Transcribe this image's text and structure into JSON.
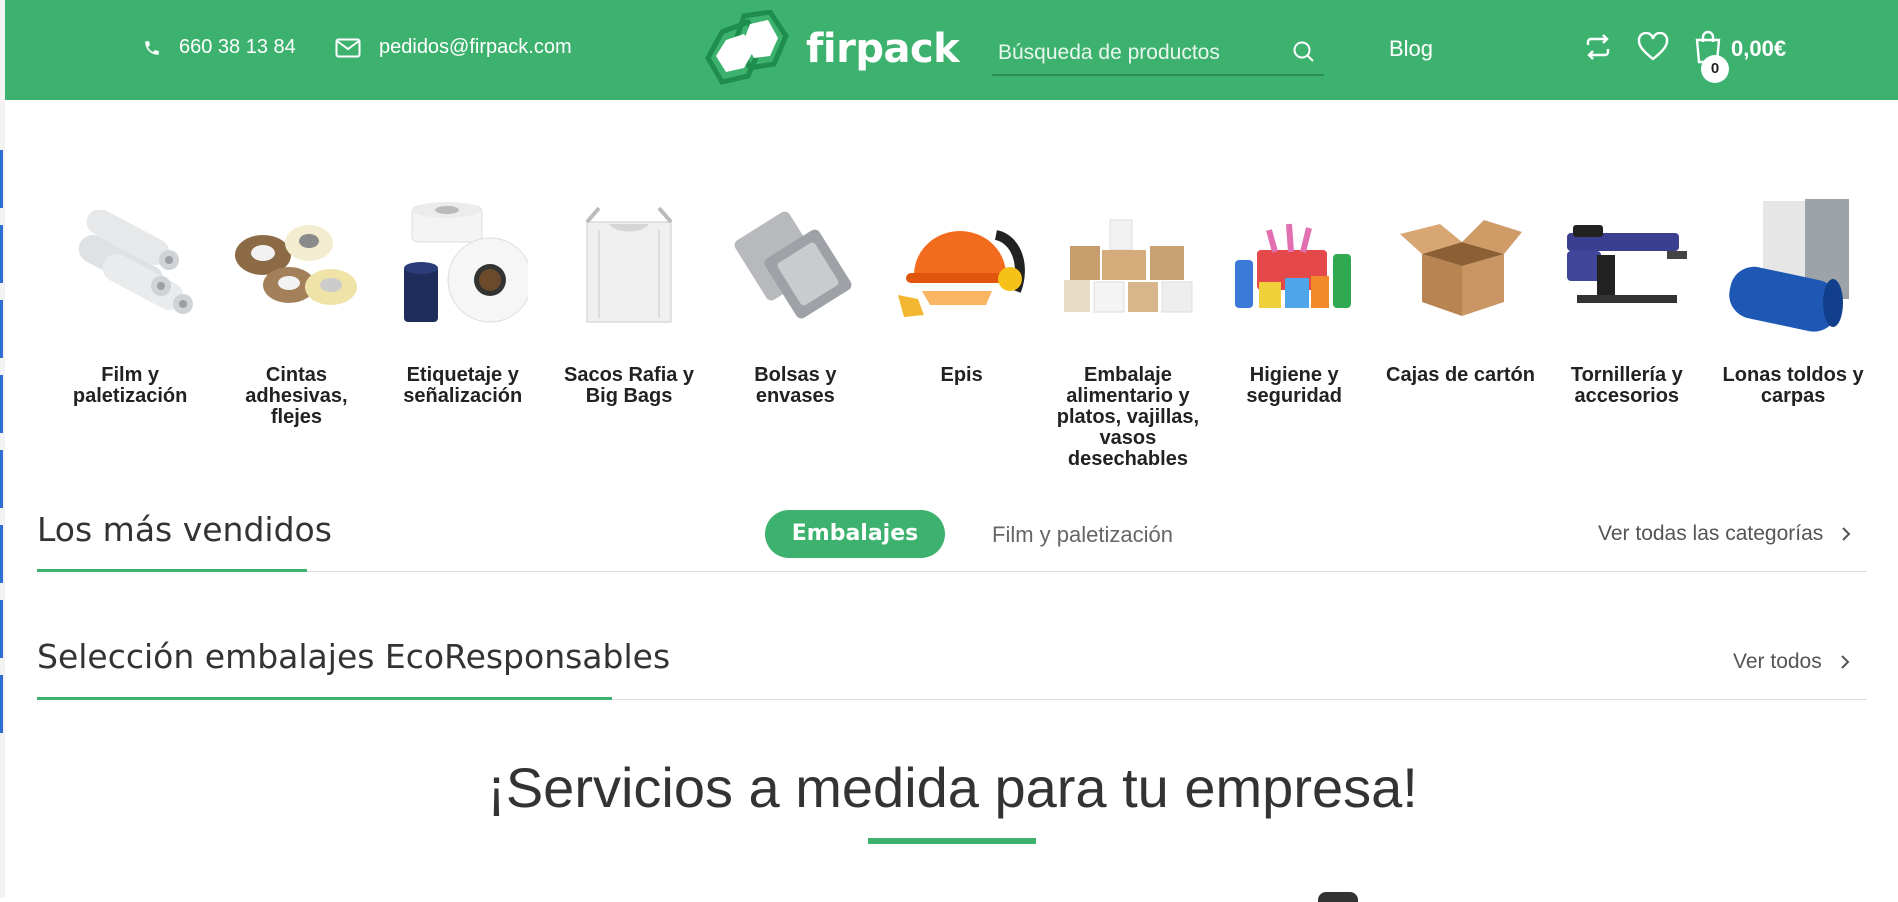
{
  "header": {
    "phone": "660 38 13 84",
    "email": "pedidos@firpack.com",
    "logo_text": "firpack",
    "search_placeholder": "Búsqueda de productos",
    "blog": "Blog",
    "cart_count": "0",
    "cart_total": "0,00€"
  },
  "categories": [
    {
      "label": "Film y paletización",
      "icon": "stretch-film-rolls"
    },
    {
      "label": "Cintas adhesivas, flejes",
      "icon": "tape-rolls"
    },
    {
      "label": "Etiquetaje y señalización",
      "icon": "label-rolls"
    },
    {
      "label": "Sacos Rafia y Big Bags",
      "icon": "big-bag"
    },
    {
      "label": "Bolsas y envases",
      "icon": "bubble-envelopes"
    },
    {
      "label": "Epis",
      "icon": "safety-helmet"
    },
    {
      "label": "Embalaje alimentario y platos, vajillas, vasos desechables",
      "icon": "food-containers"
    },
    {
      "label": "Higiene y seguridad",
      "icon": "cleaning-supplies"
    },
    {
      "label": "Cajas de cartón",
      "icon": "cardboard-box"
    },
    {
      "label": "Tornillería y accesorios",
      "icon": "staple-gun"
    },
    {
      "label": "Lonas toldos y carpas",
      "icon": "tarp-rolls"
    }
  ],
  "bestsellers": {
    "title": "Los más vendidos",
    "tabs": [
      "Embalajes",
      "Film y paletización"
    ],
    "view_all": "Ver todas las categorías"
  },
  "eco": {
    "title": "Selección embalajes EcoResponsables",
    "view_all": "Ver todos"
  },
  "services": {
    "title": "¡Servicios a medida para tu empresa!"
  },
  "colors": {
    "brand_green": "#3db26e",
    "text_dark": "#333333"
  }
}
